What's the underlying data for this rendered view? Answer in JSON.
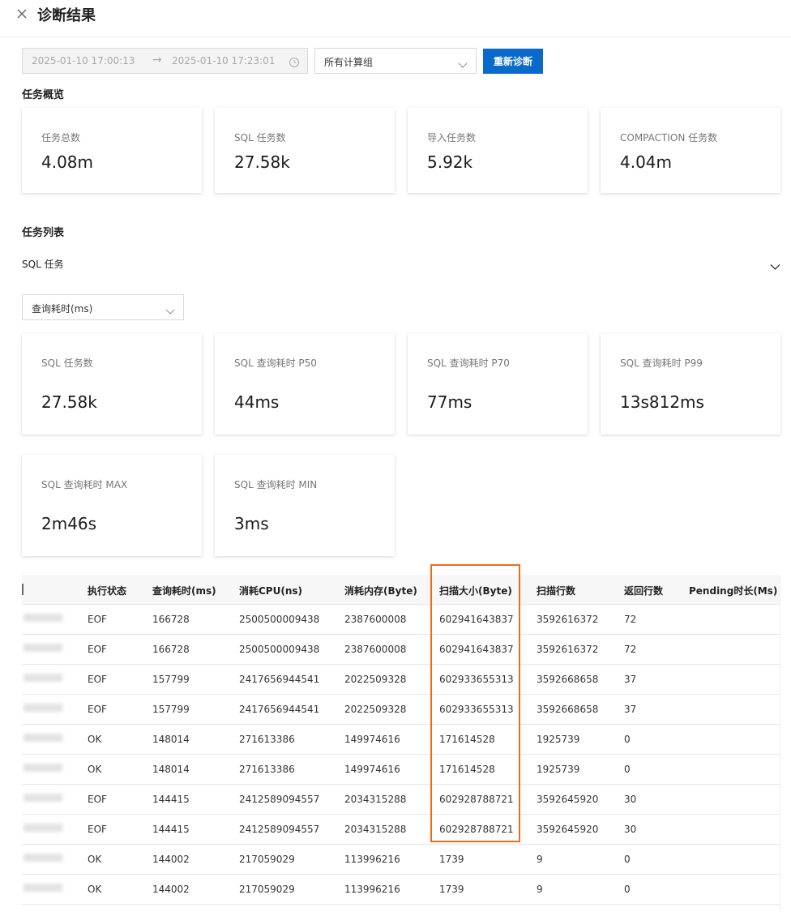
{
  "header": {
    "title": "诊断结果"
  },
  "filters": {
    "start_time": "2025-01-10 17:00:13",
    "arrow": "→",
    "end_time": "2025-01-10 17:23:01",
    "group_select": "所有计算组",
    "rediagnose_button": "重新诊断"
  },
  "overview": {
    "title": "任务概览",
    "cards": [
      {
        "label": "任务总数",
        "value": "4.08m"
      },
      {
        "label": "SQL 任务数",
        "value": "27.58k"
      },
      {
        "label": "导入任务数",
        "value": "5.92k"
      },
      {
        "label": "COMPACTION 任务数",
        "value": "4.04m"
      }
    ]
  },
  "task_list": {
    "title": "任务列表",
    "sub_title": "SQL 任务",
    "metric_select": "查询耗时(ms)",
    "cards": [
      {
        "label": "SQL 任务数",
        "value": "27.58k"
      },
      {
        "label": "SQL 查询耗时 P50",
        "value": "44ms"
      },
      {
        "label": "SQL 查询耗时 P70",
        "value": "77ms"
      },
      {
        "label": "SQL 查询耗时 P99",
        "value": "13s812ms"
      },
      {
        "label": "SQL 查询耗时 MAX",
        "value": "2m46s"
      },
      {
        "label": "SQL 查询耗时 MIN",
        "value": "3ms"
      }
    ]
  },
  "table": {
    "headers": [
      "执行状态",
      "查询耗时(ms)",
      "消耗CPU(ns)",
      "消耗内存(Byte)",
      "扫描大小(Byte)",
      "扫描行数",
      "返回行数",
      "Pending时长(Ms)"
    ],
    "rows": [
      [
        "EOF",
        "166728",
        "2500500009438",
        "2387600008",
        "602941643837",
        "3592616372",
        "72",
        ""
      ],
      [
        "EOF",
        "166728",
        "2500500009438",
        "2387600008",
        "602941643837",
        "3592616372",
        "72",
        ""
      ],
      [
        "EOF",
        "157799",
        "2417656944541",
        "2022509328",
        "602933655313",
        "3592668658",
        "37",
        ""
      ],
      [
        "EOF",
        "157799",
        "2417656944541",
        "2022509328",
        "602933655313",
        "3592668658",
        "37",
        ""
      ],
      [
        "OK",
        "148014",
        "271613386",
        "149974616",
        "171614528",
        "1925739",
        "0",
        ""
      ],
      [
        "OK",
        "148014",
        "271613386",
        "149974616",
        "171614528",
        "1925739",
        "0",
        ""
      ],
      [
        "EOF",
        "144415",
        "2412589094557",
        "2034315288",
        "602928788721",
        "3592645920",
        "30",
        ""
      ],
      [
        "EOF",
        "144415",
        "2412589094557",
        "2034315288",
        "602928788721",
        "3592645920",
        "30",
        ""
      ],
      [
        "OK",
        "144002",
        "217059029",
        "113996216",
        "1739",
        "9",
        "0",
        ""
      ],
      [
        "OK",
        "144002",
        "217059029",
        "113996216",
        "1739",
        "9",
        "0",
        ""
      ]
    ]
  },
  "colors": {
    "primary": "#0a6acb",
    "highlight": "#ee6c17"
  },
  "icons": [
    "close-icon",
    "clock-icon",
    "chevron-down-icon"
  ]
}
